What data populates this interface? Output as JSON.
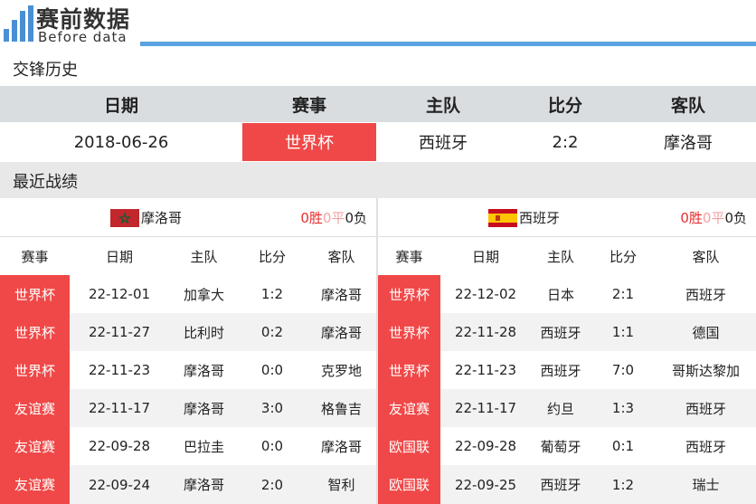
{
  "logo": {
    "title": "赛前数据",
    "subtitle": "Before data"
  },
  "h2h": {
    "title": "交锋历史",
    "headers": [
      "日期",
      "赛事",
      "主队",
      "比分",
      "客队"
    ],
    "row": [
      "2018-06-26",
      "世界杯",
      "西班牙",
      "2:2",
      "摩洛哥"
    ]
  },
  "recent": {
    "title": "最近战绩",
    "left": {
      "team": "摩洛哥",
      "record": {
        "w": "0胜",
        "d": "0平",
        "l": "0负"
      },
      "headers": [
        "赛事",
        "日期",
        "主队",
        "比分",
        "客队"
      ],
      "rows": [
        [
          "世界杯",
          "22-12-01",
          "加拿大",
          "1:2",
          "摩洛哥"
        ],
        [
          "世界杯",
          "22-11-27",
          "比利时",
          "0:2",
          "摩洛哥"
        ],
        [
          "世界杯",
          "22-11-23",
          "摩洛哥",
          "0:0",
          "克罗地"
        ],
        [
          "友谊赛",
          "22-11-17",
          "摩洛哥",
          "3:0",
          "格鲁吉"
        ],
        [
          "友谊赛",
          "22-09-28",
          "巴拉圭",
          "0:0",
          "摩洛哥"
        ],
        [
          "友谊赛",
          "22-09-24",
          "摩洛哥",
          "2:0",
          "智利"
        ]
      ]
    },
    "right": {
      "team": "西班牙",
      "record": {
        "w": "0胜",
        "d": "0平",
        "l": "0负"
      },
      "headers": [
        "赛事",
        "日期",
        "主队",
        "比分",
        "客队"
      ],
      "rows": [
        [
          "世界杯",
          "22-12-02",
          "日本",
          "2:1",
          "西班牙"
        ],
        [
          "世界杯",
          "22-11-28",
          "西班牙",
          "1:1",
          "德国"
        ],
        [
          "世界杯",
          "22-11-23",
          "西班牙",
          "7:0",
          "哥斯达黎加"
        ],
        [
          "友谊赛",
          "22-11-17",
          "约旦",
          "1:3",
          "西班牙"
        ],
        [
          "欧国联",
          "22-09-28",
          "葡萄牙",
          "0:1",
          "西班牙"
        ],
        [
          "欧国联",
          "22-09-25",
          "西班牙",
          "1:2",
          "瑞士"
        ]
      ]
    }
  },
  "colors": {
    "accent": "#f04848",
    "brand": "#4a8fd4"
  }
}
